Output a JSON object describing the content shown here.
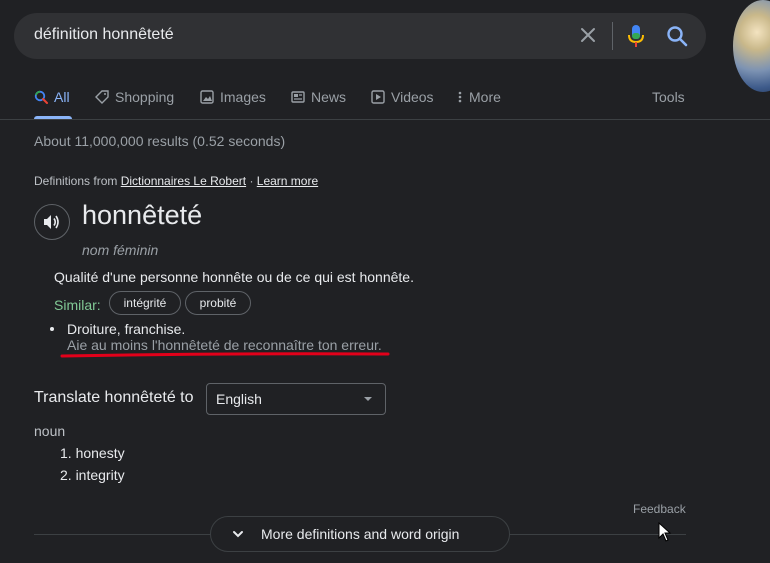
{
  "search": {
    "query": "définition honnêteté"
  },
  "tabs": [
    {
      "label": "All"
    },
    {
      "label": "Shopping"
    },
    {
      "label": "Images"
    },
    {
      "label": "News"
    },
    {
      "label": "Videos"
    },
    {
      "label": "More"
    }
  ],
  "tools_label": "Tools",
  "stats": "About 11,000,000 results (0.52 seconds)",
  "definitions_from": {
    "prefix": "Definitions from ",
    "source": "Dictionnaires Le Robert",
    "separator": " · ",
    "learn_more": "Learn more"
  },
  "entry": {
    "word": "honnêteté",
    "part_of_speech": "nom féminin",
    "definition": "Qualité d'une personne honnête ou de ce qui est honnête.",
    "similar_label": "Similar:",
    "similar": [
      "intégrité",
      "probité"
    ],
    "sense": "Droiture, franchise.",
    "example": "Aie au moins l'honnêteté de reconnaître ton erreur."
  },
  "translate": {
    "label": "Translate honnêteté to",
    "selected_language": "English",
    "pos": "noun",
    "items": [
      "1. honesty",
      "2. integrity"
    ]
  },
  "feedback": "Feedback",
  "more_button": "More definitions and word origin",
  "colors": {
    "background": "#202124",
    "accent": "#8ab4f8",
    "similar_green": "#81c995",
    "annotation_red": "#e2001a"
  }
}
